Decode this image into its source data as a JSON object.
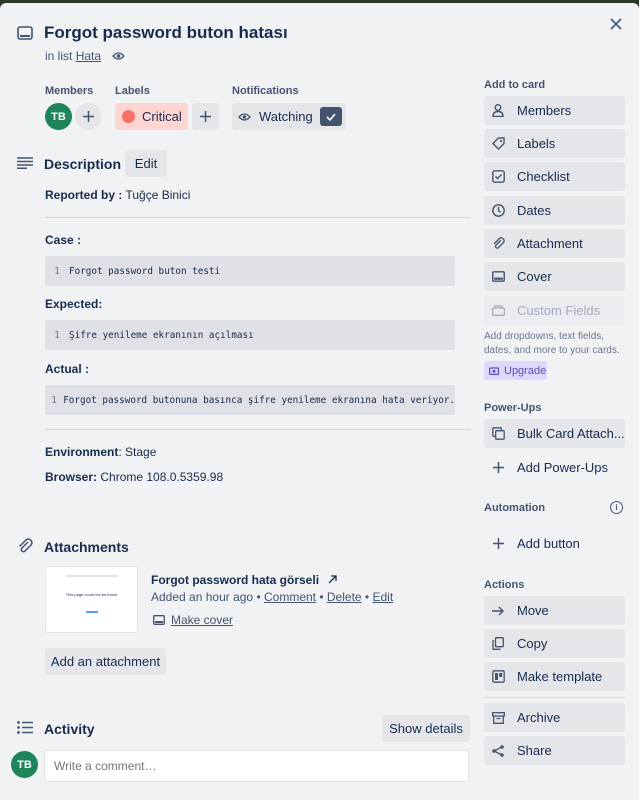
{
  "card": {
    "title": "Forgot password buton hatası",
    "in_list_prefix": "in list",
    "list_name": "Hata"
  },
  "members": {
    "label": "Members",
    "avatar_initials": "TB"
  },
  "labels": {
    "label": "Labels",
    "items": [
      {
        "name": "Critical",
        "color": "#f87168"
      }
    ]
  },
  "notifications": {
    "label": "Notifications",
    "watching_label": "Watching"
  },
  "description": {
    "heading": "Description",
    "edit_label": "Edit",
    "reported_by_label": "Reported by :",
    "reported_by_value": "Tuğçe Binici",
    "case_label": "Case :",
    "case_code": {
      "line": "1",
      "text": "Forgot password buton testi"
    },
    "expected_label": "Expected:",
    "expected_code": {
      "line": "1",
      "text": "Şifre yenileme ekranının açılması"
    },
    "actual_label": "Actual :",
    "actual_code": {
      "line": "1",
      "text": "Forgot password butonuna basınca şifre yenileme ekranına hata veriyor."
    },
    "environment_label": "Environment",
    "environment_value": ": Stage",
    "browser_label": "Browser:",
    "browser_value": "Chrome 108.0.5359.98"
  },
  "attachments": {
    "heading": "Attachments",
    "item": {
      "name": "Forgot password hata görseli",
      "added": "Added an hour ago",
      "comment": "Comment",
      "delete": "Delete",
      "edit": "Edit",
      "make_cover": "Make cover",
      "sep": "•"
    },
    "add_label": "Add an attachment"
  },
  "activity": {
    "heading": "Activity",
    "show_details": "Show details",
    "avatar_initials": "TB",
    "comment_placeholder": "Write a comment…"
  },
  "sidebar": {
    "add_to_card": "Add to card",
    "add_items": [
      {
        "label": "Members",
        "icon": "person-icon"
      },
      {
        "label": "Labels",
        "icon": "tag-icon"
      },
      {
        "label": "Checklist",
        "icon": "checklist-icon"
      },
      {
        "label": "Dates",
        "icon": "clock-icon"
      },
      {
        "label": "Attachment",
        "icon": "paperclip-icon"
      },
      {
        "label": "Cover",
        "icon": "cover-icon"
      },
      {
        "label": "Custom Fields",
        "icon": "custom-fields-icon"
      }
    ],
    "custom_fields_hint": "Add dropdowns, text fields, dates, and more to your cards.",
    "upgrade_label": "Upgrade",
    "powerups_heading": "Power-Ups",
    "powerups_items": [
      {
        "label": "Bulk Card Attach...",
        "icon": "bulk-attach-icon"
      },
      {
        "label": "Add Power-Ups",
        "icon": "plus-icon"
      }
    ],
    "automation_heading": "Automation",
    "automation_items": [
      {
        "label": "Add button",
        "icon": "plus-icon"
      }
    ],
    "actions_heading": "Actions",
    "actions_items": [
      {
        "label": "Move",
        "icon": "arrow-right-icon"
      },
      {
        "label": "Copy",
        "icon": "copy-icon"
      },
      {
        "label": "Make template",
        "icon": "template-icon"
      }
    ],
    "more_items": [
      {
        "label": "Archive",
        "icon": "archive-icon"
      },
      {
        "label": "Share",
        "icon": "share-icon"
      }
    ]
  },
  "thumbnail": {
    "caption": "This page could not be found"
  },
  "colors": {
    "avatar": "#1f845a",
    "watch_check": "#44546f",
    "upgrade_bg": "#dfd8fd",
    "upgrade_text": "#5e4db2"
  }
}
